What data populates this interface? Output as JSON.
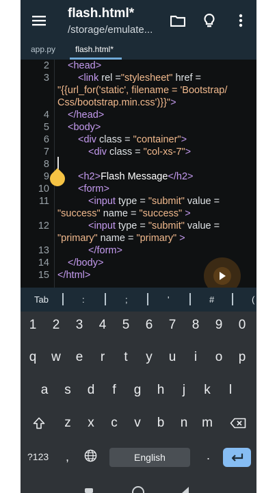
{
  "app_bar": {
    "title": "flash.html*",
    "subtitle": "/storage/emulate...",
    "icons": [
      "menu-icon",
      "folder-icon",
      "lightbulb-icon",
      "more-vert-icon"
    ]
  },
  "tabs": [
    {
      "label": "app.py",
      "active": false
    },
    {
      "label": "flash.html*",
      "active": true
    }
  ],
  "code": {
    "line_numbers": [
      "2",
      "3",
      "4",
      "5",
      "6",
      "7",
      "8",
      "9",
      "10",
      "11",
      "12",
      "13",
      "14",
      "15"
    ],
    "l2": [
      "<head>"
    ],
    "l3": [
      "<link",
      " rel =",
      "\"stylesheet\"",
      "  href =",
      "\"{{url_for('static', filename = 'Bootstrap/",
      "Css/bootstrap.min.css')}}\"",
      ">"
    ],
    "l4": [
      "</head>"
    ],
    "l5": [
      "<body>"
    ],
    "l6": [
      "<div",
      " class =",
      " \"container\"",
      ">"
    ],
    "l7": [
      "<div",
      " class =",
      " \"col-xs-7\"",
      ">"
    ],
    "l9": [
      "<h2>",
      "Flash Message",
      "</h2>"
    ],
    "l10": [
      "<form>"
    ],
    "l11": [
      "<input",
      " type =",
      " \"submit\"",
      " value =",
      "\"success\"",
      " name =",
      " \"success\"",
      " >"
    ],
    "l12": [
      "<input",
      " type =",
      " \"submit\"",
      " value =",
      "\"primary\"",
      " name =",
      " \"primary\"",
      " >"
    ],
    "l13": [
      "</form>"
    ],
    "l14": [
      "</body>"
    ],
    "l15": [
      "</html>"
    ]
  },
  "extra_keys": [
    "Tab",
    ":",
    ";",
    "'",
    "#",
    "("
  ],
  "keyboard": {
    "numbers": [
      "1",
      "2",
      "3",
      "4",
      "5",
      "6",
      "7",
      "8",
      "9",
      "0"
    ],
    "row1": [
      "q",
      "w",
      "e",
      "r",
      "t",
      "y",
      "u",
      "i",
      "o",
      "p"
    ],
    "row2": [
      "a",
      "s",
      "d",
      "f",
      "g",
      "h",
      "j",
      "k",
      "l"
    ],
    "row3": [
      "z",
      "x",
      "c",
      "v",
      "b",
      "n",
      "m"
    ],
    "symbols_key": "?123",
    "comma_key": ",",
    "space_key": "English",
    "period_key": ".",
    "enter_color": "#86bdf3"
  },
  "colors": {
    "app_bar": "#1c2b36",
    "editor_bg": "#0f1112",
    "tag": "#c59bf0",
    "string": "#f1b98d",
    "cursor_handle": "#f5c344"
  }
}
